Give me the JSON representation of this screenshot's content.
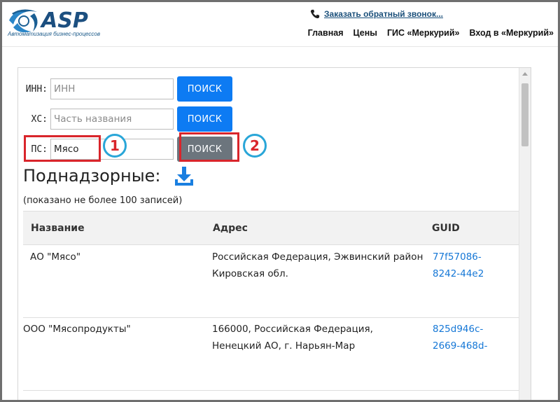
{
  "header": {
    "logo_tagline": "Автоматизация бизнес-процессов",
    "callback_link": "Заказать обратный звонок...",
    "nav": [
      "Главная",
      "Цены",
      "ГИС «Меркурий»",
      "Вход в «Меркурий»"
    ]
  },
  "search": {
    "inn": {
      "label": "ИНН:",
      "placeholder": "ИНН",
      "value": "",
      "button": "ПОИСК"
    },
    "hs": {
      "label": "ХС:",
      "placeholder": "Часть названия",
      "value": "",
      "button": "ПОИСК"
    },
    "ps": {
      "label": "ПС:",
      "placeholder": "",
      "value": "Мясо",
      "button": "ПОИСК"
    }
  },
  "annotations": {
    "step1": "1",
    "step2": "2"
  },
  "section": {
    "title": "Поднадзорные:",
    "note": "(показано не более 100 записей)"
  },
  "table": {
    "headers": [
      "Название",
      "Адрес",
      "GUID"
    ],
    "rows": [
      {
        "name": "АО \"Мясо\"",
        "address_line1": "Российская Федерация, Эжвинский район",
        "address_line2": "Кировская обл.",
        "guid_line1": "77f57086-",
        "guid_line2": "8242-44e2"
      },
      {
        "name": "ООО \"Мясопродукты\"",
        "address_line1": "166000, Российская Федерация,",
        "address_line2": "Ненецкий АО, г. Нарьян-Мар",
        "guid_line1": "825d946c-",
        "guid_line2": "2669-468d-"
      }
    ]
  },
  "colors": {
    "primary_button": "#0d7bf3",
    "active_button": "#6c757d",
    "highlight_red": "#d9252b",
    "circle_blue": "#29a6d8",
    "link": "#1577d6"
  }
}
